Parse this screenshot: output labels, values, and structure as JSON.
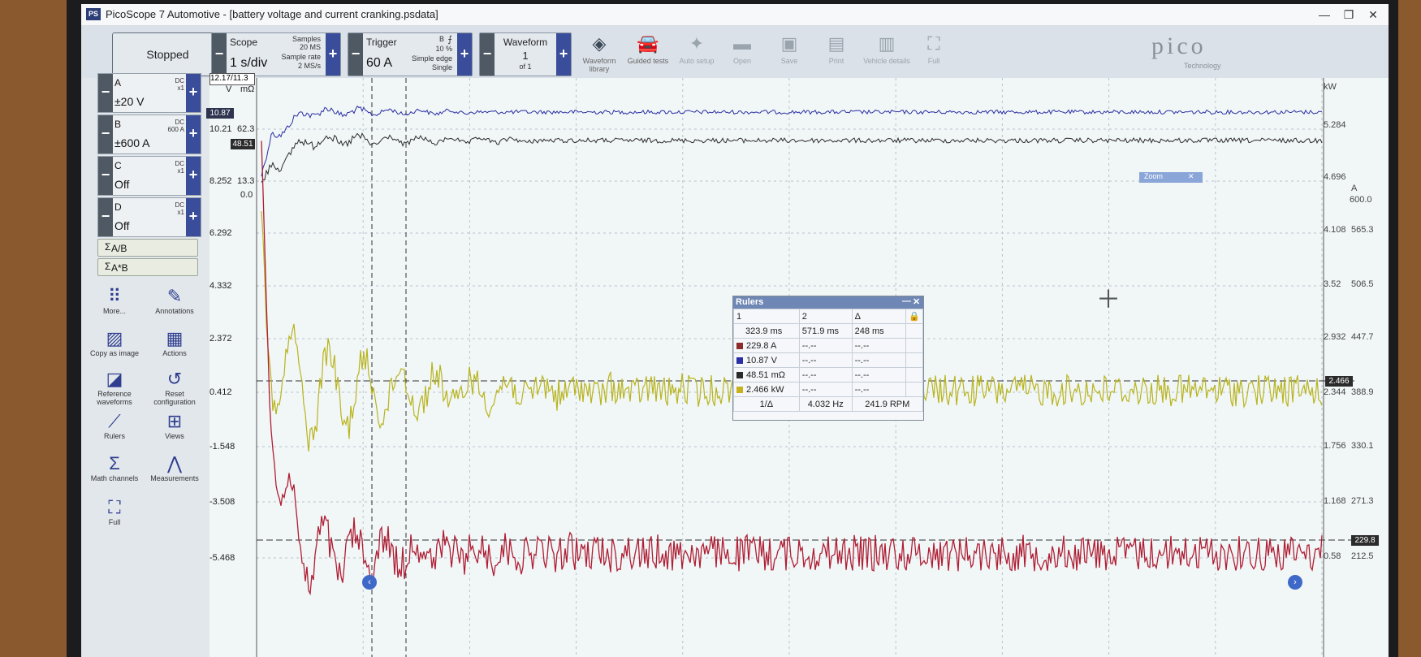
{
  "window": {
    "title": "PicoScope 7 Automotive - [battery voltage and current cranking.psdata]",
    "icon": "PS",
    "minimize": "—",
    "restore": "❐",
    "close": "✕"
  },
  "toolbar": {
    "run_state": "Stopped",
    "scope": {
      "label": "Scope",
      "timebase": "1 s/div",
      "samples_label": "Samples",
      "samples": "20 MS",
      "rate_label": "Sample rate",
      "rate": "2 MS/s"
    },
    "trigger": {
      "label": "Trigger",
      "level": "60 A",
      "channel": "B",
      "pretrigger": "10 %",
      "type": "Simple edge",
      "mode": "Single"
    },
    "waveform": {
      "label": "Waveform",
      "index": "1",
      "of": "of 1"
    },
    "tools": [
      {
        "label": "Waveform library",
        "icon": "waveform-library-icon"
      },
      {
        "label": "Guided tests",
        "icon": "car-icon"
      },
      {
        "label": "Auto setup",
        "icon": "magic-wand-icon"
      },
      {
        "label": "Open",
        "icon": "folder-icon"
      },
      {
        "label": "Save",
        "icon": "save-icon"
      },
      {
        "label": "Print",
        "icon": "print-icon"
      },
      {
        "label": "Vehicle details",
        "icon": "clipboard-icon"
      },
      {
        "label": "Full",
        "icon": "fullscreen-icon"
      }
    ],
    "logo": "pico",
    "logo_sub": "Technology"
  },
  "channels": [
    {
      "name": "A",
      "coupling": "DC",
      "probe": "x1",
      "range": "±20 V"
    },
    {
      "name": "B",
      "coupling": "DC",
      "probe": "600 A",
      "range": "±600 A"
    },
    {
      "name": "C",
      "coupling": "DC",
      "probe": "x1",
      "range": "Off"
    },
    {
      "name": "D",
      "coupling": "DC",
      "probe": "x1",
      "range": "Off"
    }
  ],
  "math_channels": [
    "A/B",
    "A*B"
  ],
  "sidebar_tools": [
    {
      "label": "More...",
      "icon": "more-dots-icon"
    },
    {
      "label": "Annotations",
      "icon": "annotations-icon"
    },
    {
      "label": "Copy as image",
      "icon": "image-icon"
    },
    {
      "label": "Actions",
      "icon": "clapperboard-icon"
    },
    {
      "label": "Reference waveforms",
      "icon": "reference-waveform-icon"
    },
    {
      "label": "Reset configuration",
      "icon": "reset-icon"
    },
    {
      "label": "Rulers",
      "icon": "ruler-icon"
    },
    {
      "label": "Views",
      "icon": "views-grid-icon"
    },
    {
      "label": "Math channels",
      "icon": "sigma-icon"
    },
    {
      "label": "Measurements",
      "icon": "compass-icon"
    },
    {
      "label": "Full",
      "icon": "fullscreen-icon"
    }
  ],
  "plot": {
    "header_values": [
      "12.17",
      "11.3"
    ],
    "units": [
      "V",
      "mΩ"
    ],
    "left_axis_ticks": [
      "10.21",
      "8.252",
      "6.292",
      "4.332",
      "2.372",
      "0.412",
      "-1.548",
      "-3.508",
      "-5.468"
    ],
    "resistance_ticks": [
      "62.3",
      "13.3",
      "0.0"
    ],
    "right_inner_ticks": [
      "5.284",
      "4.696",
      "4.108",
      "3.52",
      "2.932",
      "2.344",
      "1.756",
      "1.168",
      "0.58"
    ],
    "right_outer_ticks": [
      "600.0",
      "565.3",
      "506.5",
      "447.7",
      "388.9",
      "330.1",
      "271.3",
      "212.5"
    ],
    "right_units": [
      "kW",
      "A"
    ],
    "ruler_tags": {
      "voltage": "10.87",
      "resistance": "48.51",
      "power": "2.466",
      "current": "229.8"
    },
    "colors": {
      "voltage": "#2a2ea3",
      "resistance": "#2b2b2b",
      "power": "#b8b41d",
      "current": "#b01e34"
    }
  },
  "zoom_panel": {
    "label": "Zoom"
  },
  "rulers_panel": {
    "title": "Rulers",
    "col_headers": [
      "1",
      "2",
      "Δ"
    ],
    "times": [
      "323.9 ms",
      "571.9 ms",
      "248 ms"
    ],
    "rows": [
      {
        "color": "#8e2b2b",
        "value": "229.8 A",
        "v2": "--.--",
        "delta": "--.--"
      },
      {
        "color": "#2a2ea3",
        "value": "10.87 V",
        "v2": "--.--",
        "delta": "--.--"
      },
      {
        "color": "#2b2b2b",
        "value": "48.51 mΩ",
        "v2": "--.--",
        "delta": "--.--"
      },
      {
        "color": "#c7b21c",
        "value": "2.466 kW",
        "v2": "--.--",
        "delta": "--.--"
      }
    ],
    "freq_label": "1/Δ",
    "freq": "4.032 Hz",
    "rpm": "241.9 RPM"
  }
}
